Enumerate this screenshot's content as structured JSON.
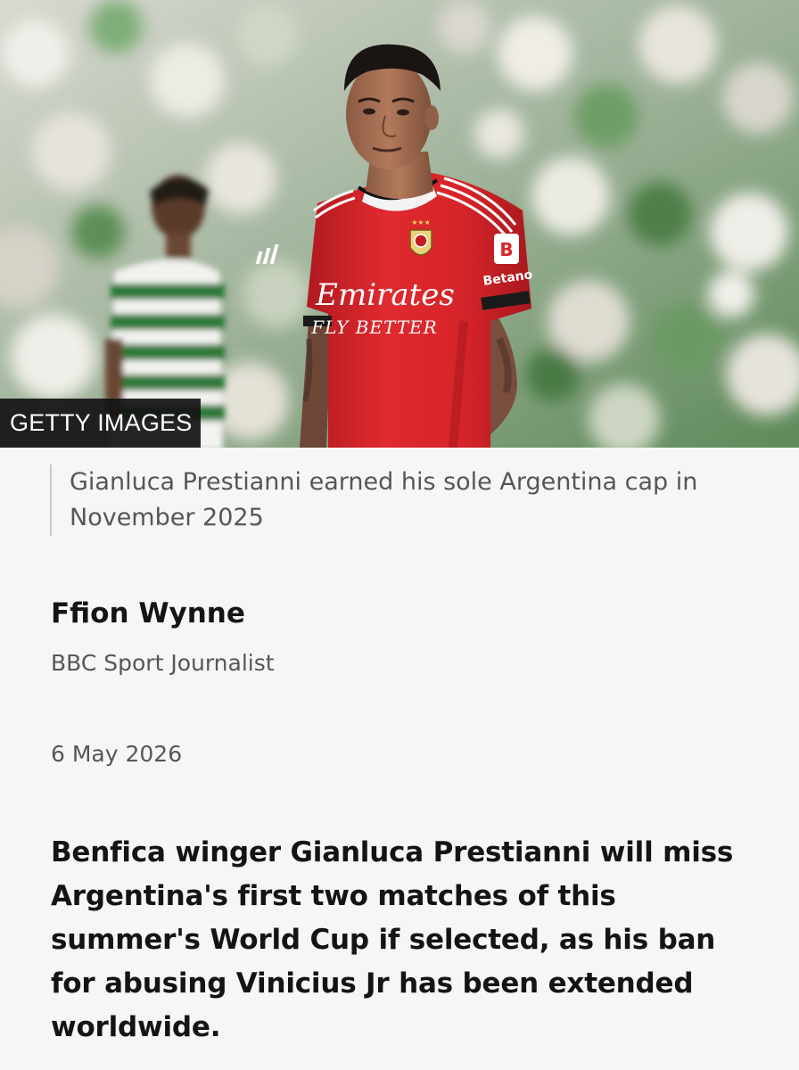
{
  "image": {
    "credit": "GETTY IMAGES",
    "shirt_sponsor_line1": "Emirates",
    "shirt_sponsor_line2": "FLY BETTER",
    "sleeve_sponsor": "Betano"
  },
  "caption": "Gianluca Prestianni earned his sole Argentina cap in November 2025",
  "author": {
    "name": "Ffion Wynne",
    "role": "BBC Sport Journalist"
  },
  "date": "6 May 2026",
  "lead": "Benfica winger Gianluca Prestianni will miss Argentina's first two matches of this summer's World Cup if selected, as his ban for abusing Vinicius Jr has been extended worldwide.",
  "colors": {
    "background": "#f6f6f6",
    "text_primary": "#141414",
    "text_secondary": "#545658",
    "caption_rule": "#c9c9c9",
    "shirt_red": "#d9262b"
  }
}
